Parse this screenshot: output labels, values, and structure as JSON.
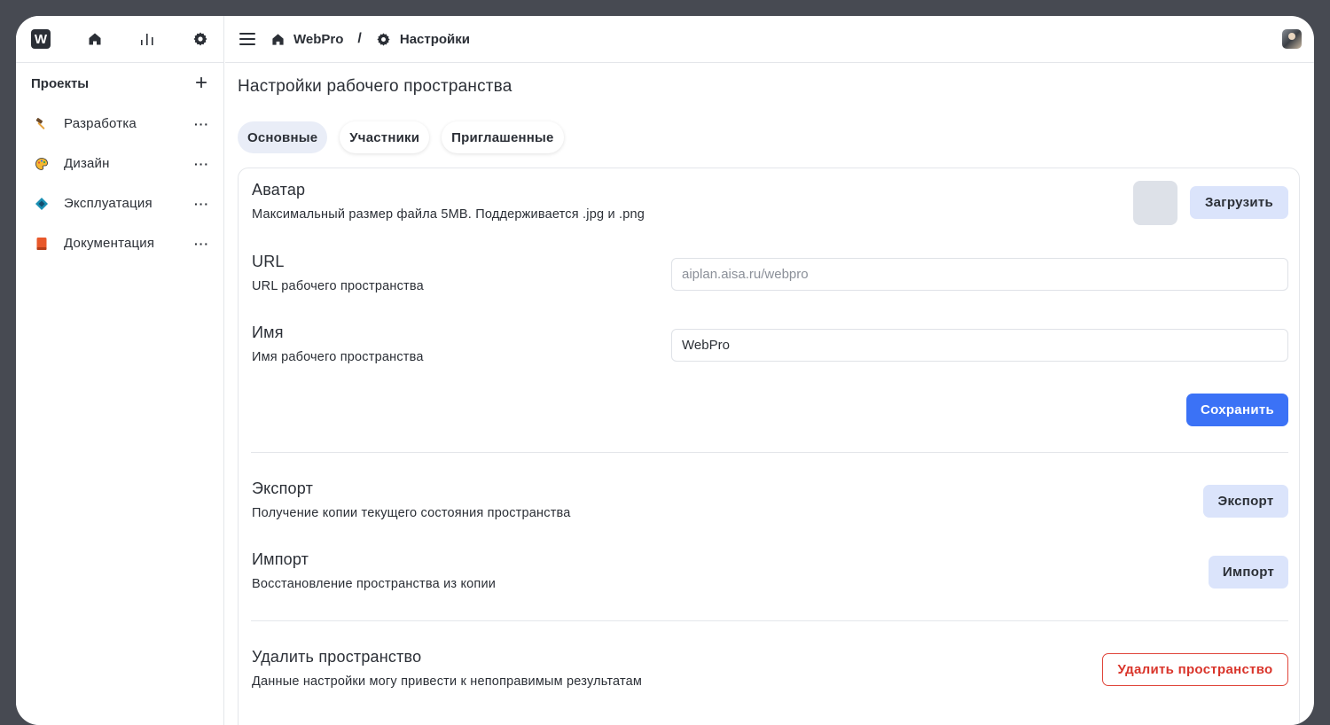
{
  "app": {
    "logo_letter": "W"
  },
  "sidebar": {
    "projects_title": "Проекты",
    "add_icon": "plus-icon",
    "items": [
      {
        "label": "Разработка",
        "icon": "hammer-icon"
      },
      {
        "label": "Дизайн",
        "icon": "palette-icon"
      },
      {
        "label": "Эксплуатация",
        "icon": "diamond-icon"
      },
      {
        "label": "Документация",
        "icon": "book-icon"
      }
    ],
    "more_label": "···"
  },
  "breadcrumb": {
    "workspace": "WebPro",
    "separator": "/",
    "page": "Настройки"
  },
  "page": {
    "title": "Настройки рабочего пространства"
  },
  "tabs": [
    {
      "label": "Основные",
      "active": true
    },
    {
      "label": "Участники",
      "active": false
    },
    {
      "label": "Приглашенные",
      "active": false
    }
  ],
  "settings": {
    "avatar": {
      "title": "Аватар",
      "desc": "Максимальный размер файла 5MB. Поддерживается .jpg и .png",
      "upload_label": "Загрузить"
    },
    "url": {
      "title": "URL",
      "desc": "URL рабочего пространства",
      "placeholder": "aiplan.aisa.ru/webpro",
      "value": ""
    },
    "name": {
      "title": "Имя",
      "desc": "Имя рабочего пространства",
      "value": "WebPro"
    },
    "save_label": "Сохранить",
    "export": {
      "title": "Экспорт",
      "desc": "Получение копии текущего состояния пространства",
      "button": "Экспорт"
    },
    "import": {
      "title": "Импорт",
      "desc": "Восстановление пространства из копии",
      "button": "Импорт"
    },
    "delete": {
      "title": "Удалить пространство",
      "desc": "Данные настройки могу привести к непоправимым результатам",
      "button": "Удалить пространство"
    }
  },
  "colors": {
    "primary": "#3b72f6",
    "light_button": "#dbe4fb",
    "danger": "#d9342a",
    "frame": "#474a52"
  }
}
